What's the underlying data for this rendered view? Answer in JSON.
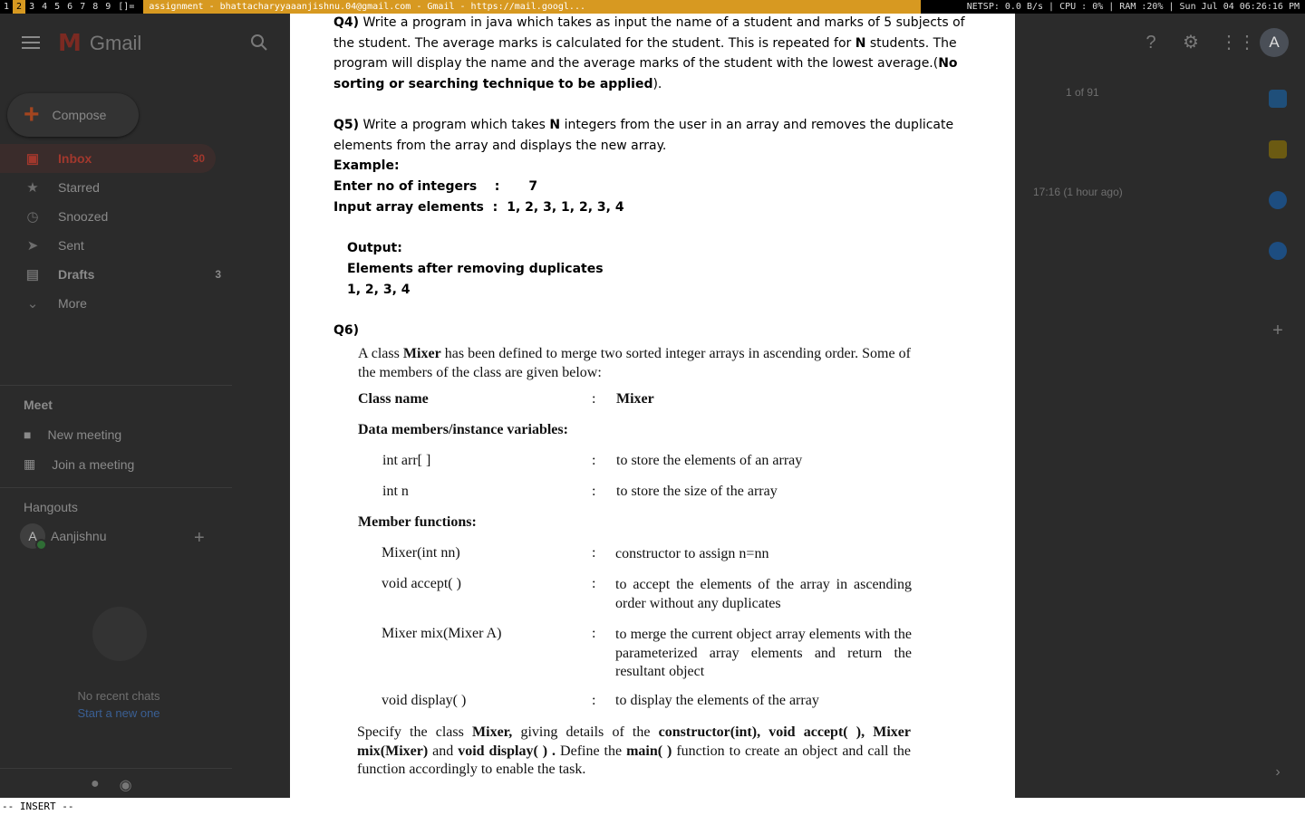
{
  "wm": {
    "tags": [
      "1",
      "2",
      "3",
      "4",
      "5",
      "6",
      "7",
      "8",
      "9"
    ],
    "active_tag": "2",
    "layout": "[]=",
    "window_title": "assignment - bhattacharyyaaanjishnu.04@gmail.com - Gmail - https://mail.googl...",
    "status": "NETSP: 0.0 B/s | CPU : 0% | RAM :20% | Sun Jul 04 06:26:16 PM"
  },
  "gmail": {
    "logo_text": "Gmail",
    "search_placeholder": "S",
    "compose_label": "Compose",
    "nav": [
      {
        "label": "Inbox",
        "count": "30",
        "icon": "inbox-icon"
      },
      {
        "label": "Starred",
        "count": "",
        "icon": "star-icon"
      },
      {
        "label": "Snoozed",
        "count": "",
        "icon": "clock-icon"
      },
      {
        "label": "Sent",
        "count": "",
        "icon": "send-icon"
      },
      {
        "label": "Drafts",
        "count": "3",
        "icon": "file-icon"
      },
      {
        "label": "More",
        "count": "",
        "icon": "chevron-down-icon"
      }
    ],
    "meet": {
      "title": "Meet",
      "new_meeting": "New meeting",
      "join_meeting": "Join a meeting"
    },
    "hangouts": {
      "title": "Hangouts",
      "user_initial": "A",
      "user_name": "Aanjishnu",
      "no_chats": "No recent chats",
      "start_chat": "Start a new one"
    },
    "pager": "1 of 91",
    "timestamp": "17:16 (1 hour ago)",
    "avatar_initial": "A",
    "colors": {
      "accent": "#a2382d",
      "background": "#2b2b2b"
    }
  },
  "document": {
    "q4": {
      "label": "Q4)",
      "text_1": " Write a program in java which takes as input the name of a student and marks of 5 subjects of the student. The average marks is calculated for the student. This is repeated for ",
      "n": "N",
      "text_2": " students. The program will display the name and the average marks of the student with the lowest average.(",
      "bold": "No sorting or searching technique to be applied",
      "text_3": ")."
    },
    "q5": {
      "label": "Q5)",
      "text_1": " Write a program which takes ",
      "n": "N",
      "text_2": " integers from the user in an array and removes the duplicate elements from the array and displays the new array.",
      "example": "Example:",
      "enter_label": "Enter no of integers    :",
      "enter_value": "7",
      "input_label": "Input array elements  :",
      "input_value": "1, 2, 3, 1, 2, 3, 4",
      "output": "Output:",
      "output_line1": "Elements after removing duplicates",
      "output_line2": "1, 2, 3, 4"
    },
    "q6": {
      "label": "Q6)",
      "intro_1": "A class ",
      "intro_bold": "Mixer",
      "intro_2": " has been defined to merge two sorted integer arrays in ascending order. Some of the members of the class are given below:",
      "class_name_label": "Class name",
      "class_name_value": "Mixer",
      "data_members_heading": "Data members/instance variables:",
      "members": [
        {
          "name": "int arr[ ]",
          "desc": "to store the elements of an array"
        },
        {
          "name": "int n",
          "desc": "to store the size of the array"
        }
      ],
      "functions_heading": "Member functions:",
      "functions": [
        {
          "name": "Mixer(int nn)",
          "desc": "constructor to assign n=nn"
        },
        {
          "name": "void accept( )",
          "desc": "to accept the elements of the array in ascending order without any duplicates"
        },
        {
          "name": "Mixer mix(Mixer A)",
          "desc": "to merge the current object array elements with the parameterized array elements and return the resultant object"
        },
        {
          "name": "void display( )",
          "desc": "to display the elements of the array"
        }
      ],
      "spec_1": "Specify the class ",
      "spec_b1": "Mixer,",
      "spec_2": " giving details of the ",
      "spec_b2": "constructor(int), void accept( ), Mixer mix(Mixer)",
      "spec_3": " and ",
      "spec_b3": "void display( ) .",
      "spec_4": " Define the ",
      "spec_b4": "main( )",
      "spec_5": " function to create an object and call the function accordingly to enable the task.",
      "colon": ":"
    }
  },
  "vim": {
    "mode": "-- INSERT --"
  }
}
